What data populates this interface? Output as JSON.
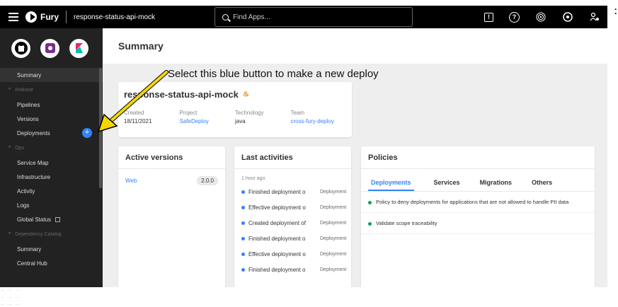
{
  "topbar": {
    "app_name": "Fury",
    "project": "response-status-api-mock",
    "search_placeholder": "Find Apps..."
  },
  "sidebar": {
    "summary": "Summary",
    "release_section": "Release",
    "pipelines": "Pipelines",
    "versions": "Versions",
    "deployments": "Deployments",
    "plus": "+",
    "ops_section": "Ops",
    "service_map": "Service Map",
    "infrastructure": "Infrastructure",
    "activity": "Activity",
    "logs": "Logs",
    "global_status": "Global Status",
    "dependency_section": "Dependency Catalog",
    "dep_summary": "Summary",
    "central_hub": "Central Hub"
  },
  "main": {
    "title": "Summary",
    "annotation": "Select this blue button to make a new deploy"
  },
  "project_card": {
    "name": "response-status-api-mock",
    "created_label": "Created",
    "created_value": "18/11/2021",
    "project_label": "Project",
    "project_value": "SafeDeploy",
    "technology_label": "Technology",
    "technology_value": "java",
    "team_label": "Team",
    "team_value": "cross-fury-deploy"
  },
  "active_versions": {
    "title": "Active versions",
    "items": [
      {
        "name": "Web",
        "version": "2.0.0"
      }
    ]
  },
  "last_activities": {
    "title": "Last activities",
    "time": "1 hour ago",
    "items": [
      {
        "text": "Finished deployment o",
        "type": "Deployment"
      },
      {
        "text": "Effective deployment o",
        "type": "Deployment"
      },
      {
        "text": "Created deployment of",
        "type": "Deployment"
      },
      {
        "text": "Finished deployment o",
        "type": "Deployment"
      },
      {
        "text": "Effective deployment o",
        "type": "Deployment"
      },
      {
        "text": "Finished deployment o",
        "type": "Deployment"
      }
    ]
  },
  "policies": {
    "title": "Policies",
    "tabs": [
      "Deployments",
      "Services",
      "Migrations",
      "Others"
    ],
    "items": [
      "Policy to deny deployments for applications that are not allowed to handle PII data",
      "Validate scope traceability"
    ]
  },
  "colors": {
    "accent": "#3483fa",
    "annotation_arrow": "#f5d800",
    "success": "#00a650"
  }
}
